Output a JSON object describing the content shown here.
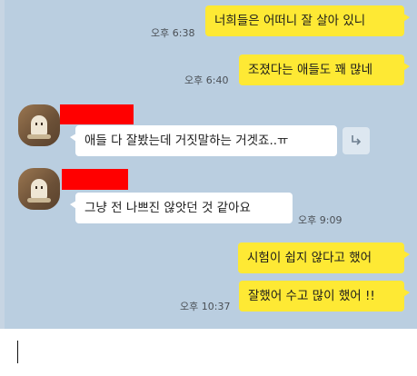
{
  "messages": [
    {
      "side": "me",
      "text": "너희들은 어떠니 잘 살아 있니",
      "time": "오후 6:38"
    },
    {
      "side": "me",
      "text": "조졌다는 애들도 꽤 많네",
      "time": "오후 6:40"
    },
    {
      "side": "them",
      "text": "애들 다 잘봤는데 거짓말하는 거겟죠..ㅠ",
      "time": ""
    },
    {
      "side": "them",
      "text": "그냥 전 나쁘진 않앗던 것 같아요",
      "time": "오후 9:09"
    },
    {
      "side": "me",
      "text": "시험이 쉽지 않다고 했어",
      "time": ""
    },
    {
      "side": "me",
      "text": "잘했어 수고 많이 했어 !!",
      "time": "오후 10:37"
    }
  ],
  "icons": {
    "share": "share-forward-icon",
    "avatar": "profile-avatar"
  },
  "colors": {
    "chat_bg": "#bacee0",
    "my_bubble": "#fee934",
    "their_bubble": "#ffffff",
    "redaction": "#ff0000"
  },
  "composer": {
    "value": ""
  }
}
